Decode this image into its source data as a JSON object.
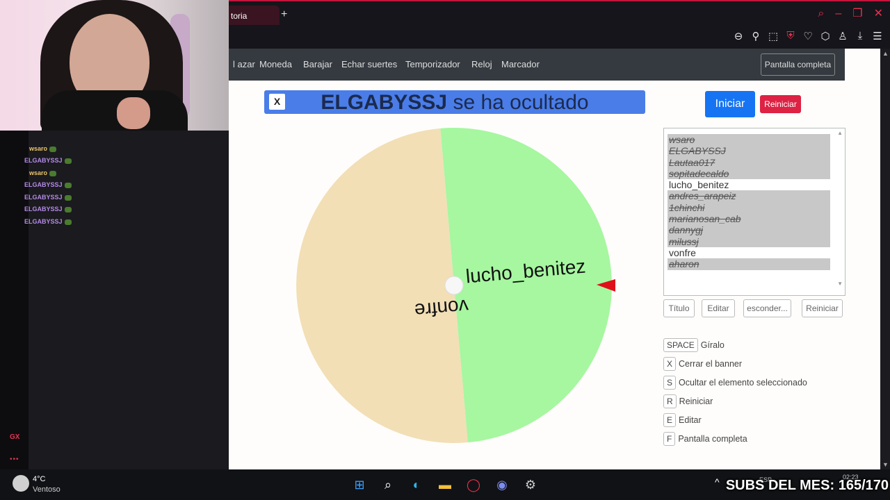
{
  "browser": {
    "active_tab_title": "toria",
    "new_tab_label": "+",
    "window_controls": [
      "⌕",
      "–",
      "❐",
      "✕"
    ],
    "toolbar_icons": [
      "zoom-out-icon",
      "pin-icon",
      "screenshot-icon",
      "shield-icon",
      "heart-icon",
      "extensions-icon",
      "account-icon",
      "download-icon",
      "menu-icon"
    ]
  },
  "site_nav": {
    "items": [
      "l azar",
      "Moneda",
      "Barajar",
      "Echar suertes",
      "Temporizador",
      "Reloj",
      "Marcador"
    ],
    "fullscreen_button": "Pantalla completa"
  },
  "banner": {
    "close_label": "X",
    "name": "ELGABYSSJ",
    "message": " se ha ocultado"
  },
  "controls": {
    "start_button": "Iniciar",
    "reset_button": "Reiniciar"
  },
  "wheel": {
    "segments": [
      {
        "label": "lucho_benitez",
        "color": "#a6f7a0"
      },
      {
        "label": "vonfre",
        "color": "#f2dfb6"
      }
    ],
    "pointer_color": "#e0101a"
  },
  "entries": [
    {
      "name": "wsaro",
      "hidden": true
    },
    {
      "name": "ELGABYSSJ",
      "hidden": true
    },
    {
      "name": "Lautaa017",
      "hidden": true
    },
    {
      "name": "sopitadecaldo",
      "hidden": true
    },
    {
      "name": "lucho_benitez",
      "hidden": false
    },
    {
      "name": "andres_arapeiz",
      "hidden": true
    },
    {
      "name": "1chinchi",
      "hidden": true
    },
    {
      "name": "marianosan_cab",
      "hidden": true
    },
    {
      "name": "dannygj",
      "hidden": true
    },
    {
      "name": "milussj",
      "hidden": true
    },
    {
      "name": "vonfre",
      "hidden": false
    },
    {
      "name": "aharon",
      "hidden": true
    }
  ],
  "entry_buttons": [
    "Título",
    "Editar",
    "esconder...",
    "Reiniciar"
  ],
  "shortcuts": [
    {
      "key": "SPACE",
      "desc": "Gíralo"
    },
    {
      "key": "X",
      "desc": "Cerrar el banner"
    },
    {
      "key": "S",
      "desc": "Ocultar el elemento seleccionado"
    },
    {
      "key": "R",
      "desc": "Reiniciar"
    },
    {
      "key": "E",
      "desc": "Editar"
    },
    {
      "key": "F",
      "desc": "Pantalla completa"
    }
  ],
  "chat": {
    "lines": [
      "wsaro",
      "ELGABYSSJ",
      "wsaro",
      "ELGABYSSJ",
      "ELGABYSSJ",
      "ELGABYSSJ",
      "ELGABYSSJ"
    ],
    "sidebar_label": "GX",
    "more_label": "•••"
  },
  "taskbar": {
    "temperature": "4°C",
    "weather": "Ventoso",
    "lang": "ESP",
    "time": "02:23",
    "chevron": "^"
  },
  "overlay": {
    "subs_text": "SUBS DEL MES: 165/170"
  }
}
